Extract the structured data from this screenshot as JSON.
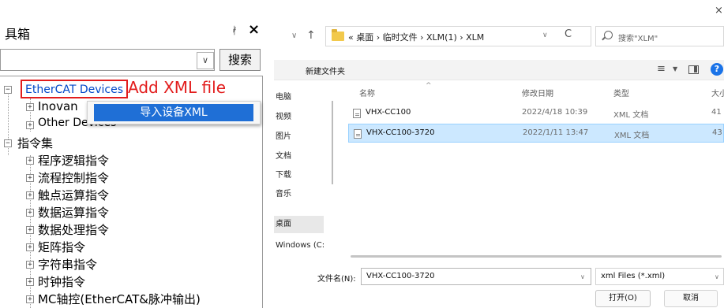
{
  "toolbox": {
    "title": "工具箱",
    "title_visible": "具箱",
    "pin_glyph": "ᚯ",
    "close_glyph": "×",
    "search_value": "",
    "search_button": "搜索",
    "annotation": "Add XML file",
    "context_menu": {
      "item": "导入设备XML"
    },
    "tree": {
      "ethercat": "EtherCAT Devices",
      "inovance": "Inovance",
      "inovance_visible": "Inovan",
      "other_devices": "Other Devices",
      "instruction_set": "指令集",
      "categories": [
        "程序逻辑指令",
        "流程控制指令",
        "触点运算指令",
        "数据运算指令",
        "数据处理指令",
        "矩阵指令",
        "字符串指令",
        "时钟指令",
        "MC轴控(EtherCAT&脉冲输出)"
      ]
    }
  },
  "dialog": {
    "close_glyph": "×",
    "address_path": "« 桌面 › 临时文件 › XLM(1) › XLM",
    "search_placeholder": "搜索\"XLM\"",
    "new_folder": "新建文件夹",
    "nav_items": [
      "电脑",
      "视频",
      "图片",
      "文档",
      "下载",
      "音乐",
      "桌面",
      "Windows (C:)"
    ],
    "nav_items_visible": [
      "电脑",
      "ë频",
      "目片",
      "文档",
      "下载",
      "音乐",
      "桌面",
      "Vindows (C:)"
    ],
    "columns": {
      "name": "名称",
      "date": "修改日期",
      "type": "类型",
      "size": "大小"
    },
    "files": [
      {
        "name": "VHX-CC100",
        "date": "2022/4/18 10:39",
        "type": "XML 文档",
        "size": "41"
      },
      {
        "name": "VHX-CC100-3720",
        "date": "2022/1/11 13:47",
        "type": "XML 文档",
        "size": "43"
      }
    ],
    "filename_label": "文件名(N):",
    "filename_value": "VHX-CC100-3720",
    "filter": "xml Files (*.xml)",
    "open_button": "打开(O)",
    "cancel_button": "取消"
  },
  "colors": {
    "annotation_red": "#e21c1c",
    "link_blue": "#0047c8",
    "menu_highlight": "#1f6fd6",
    "selection_blue": "#cce8ff"
  }
}
